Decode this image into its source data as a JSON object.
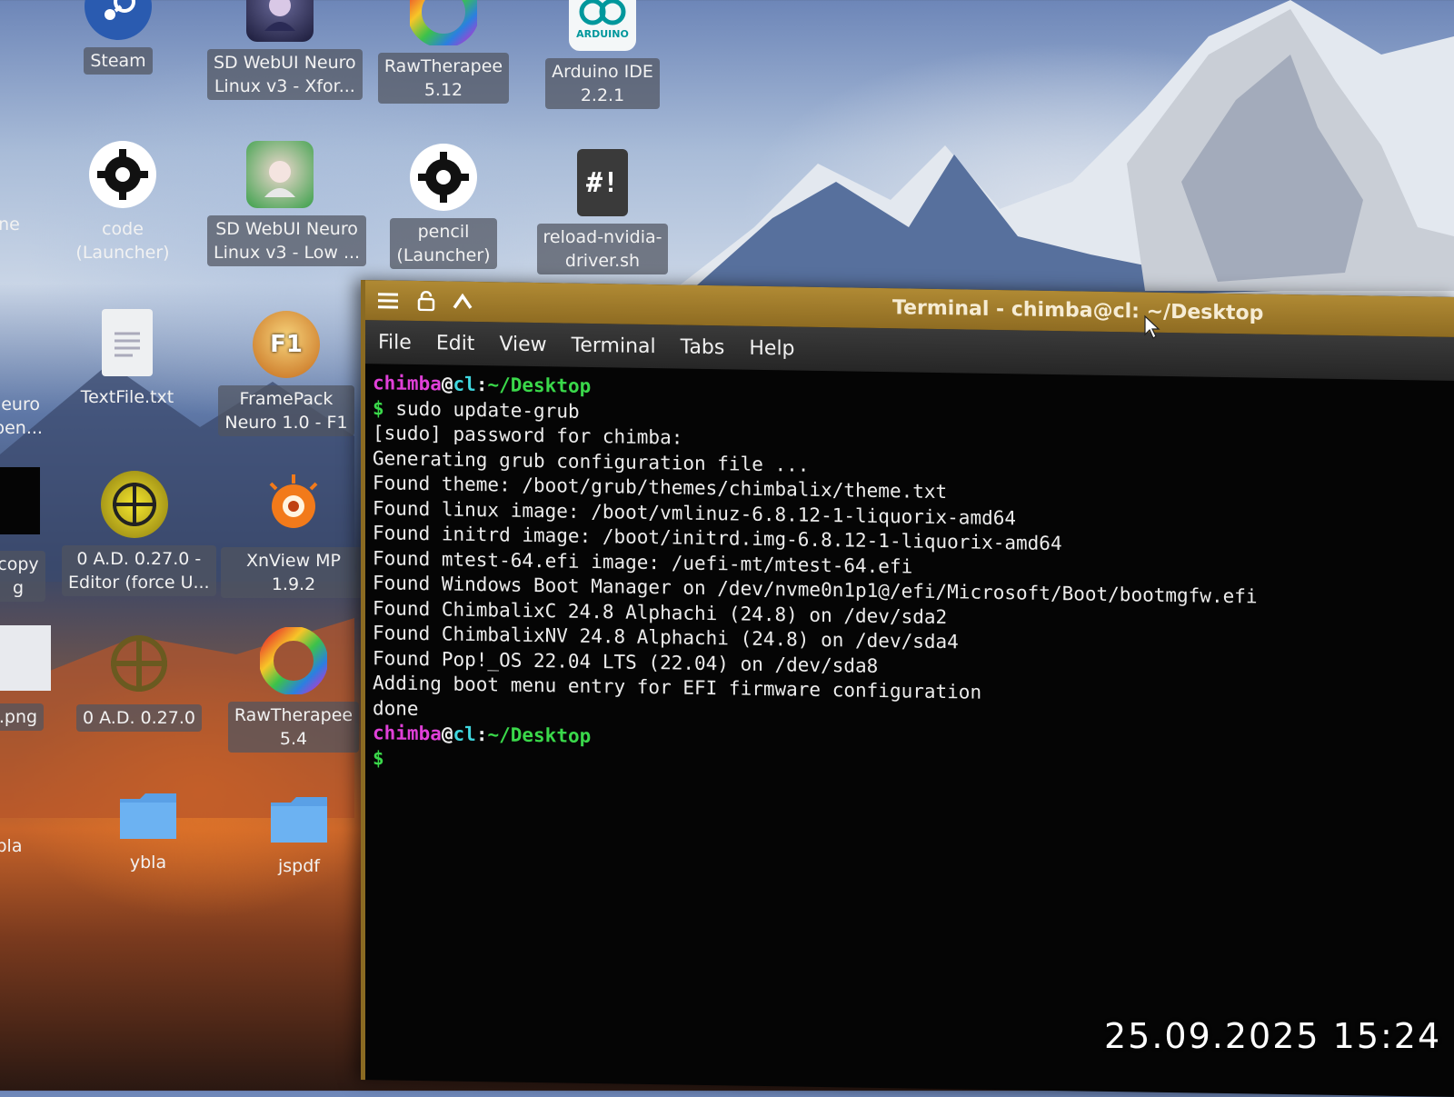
{
  "desktop": {
    "icons": [
      {
        "id": "steam",
        "label": "Steam",
        "icon": "steam-icon"
      },
      {
        "id": "sdwebui-xformers",
        "label": "SD WebUI Neuro\nLinux v3 - Xfor...",
        "icon": "anime-avatar-icon"
      },
      {
        "id": "rawtherapee-512",
        "label": "RawTherapee\n5.12",
        "icon": "color-wheel-icon"
      },
      {
        "id": "arduino",
        "label": "Arduino IDE\n2.2.1",
        "icon": "arduino-icon",
        "icon_text": "ARDUINO"
      },
      {
        "id": "partial-ne",
        "label": "ne",
        "icon": "partial-icon"
      },
      {
        "id": "code-launcher",
        "label": "code (Launcher)",
        "icon": "gear-icon"
      },
      {
        "id": "sdwebui-low",
        "label": "SD WebUI Neuro\nLinux v3 - Low ...",
        "icon": "anime-avatar-icon"
      },
      {
        "id": "pencil-launcher",
        "label": "pencil\n(Launcher)",
        "icon": "gear-icon"
      },
      {
        "id": "reload-nvidia",
        "label": "reload-nvidia-\ndriver.sh",
        "icon": "script-icon",
        "icon_text": "#!"
      },
      {
        "id": "partial-neuro",
        "label": "leuro\npen...",
        "icon": "partial-icon"
      },
      {
        "id": "textfile",
        "label": "TextFile.txt",
        "icon": "text-file-icon"
      },
      {
        "id": "framepack",
        "label": "FramePack\nNeuro 1.0 - F1",
        "icon": "framepack-icon",
        "icon_text": "F1"
      },
      {
        "id": "partial-copy",
        "label": "copy\ng",
        "icon": "partial-icon"
      },
      {
        "id": "0ad-editor",
        "label": "0 A.D. 0.27.0 -\nEditor (force U...",
        "icon": "crosshair-icon"
      },
      {
        "id": "xnview",
        "label": "XnView MP 1.9.2",
        "icon": "xnview-icon"
      },
      {
        "id": "partial-png",
        "label": ".png",
        "icon": "partial-icon"
      },
      {
        "id": "0ad",
        "label": "0 A.D. 0.27.0",
        "icon": "crosshair-icon"
      },
      {
        "id": "rawtherapee-54",
        "label": "RawTherapee\n5.4",
        "icon": "color-wheel-icon"
      },
      {
        "id": "partial-bla",
        "label": "bla",
        "icon": "partial-icon"
      },
      {
        "id": "ybla",
        "label": "ybla",
        "icon": "folder-icon"
      },
      {
        "id": "jspdf",
        "label": "jspdf",
        "icon": "folder-icon"
      }
    ]
  },
  "terminal": {
    "title": "Terminal - chimba@cl: ~/Desktop",
    "menu": [
      "File",
      "Edit",
      "View",
      "Terminal",
      "Tabs",
      "Help"
    ],
    "prompt": {
      "user": "chimba",
      "at": "@",
      "host": "cl",
      "sep": ":",
      "path": "~/Desktop",
      "dollar": "$"
    },
    "command": "sudo update-grub",
    "output": [
      "[sudo] password for chimba:",
      "Generating grub configuration file ...",
      "Found theme: /boot/grub/themes/chimbalix/theme.txt",
      "Found linux image: /boot/vmlinuz-6.8.12-1-liquorix-amd64",
      "Found initrd image: /boot/initrd.img-6.8.12-1-liquorix-amd64",
      "Found mtest-64.efi image: /uefi-mt/mtest-64.efi",
      "Found Windows Boot Manager on /dev/nvme0n1p1@/efi/Microsoft/Boot/bootmgfw.efi",
      "Found ChimbalixC 24.8 Alphachi (24.8) on /dev/sda2",
      "Found ChimbalixNV 24.8 Alphachi (24.8) on /dev/sda4",
      "Found Pop!_OS 22.04 LTS (22.04) on /dev/sda8",
      "Adding boot menu entry for EFI firmware configuration",
      "done"
    ]
  },
  "photo_timestamp": "25.09.2025 15:24",
  "colors": {
    "title_bar": "#9c7a2a",
    "prompt_user": "#e040d8",
    "prompt_host": "#40d8e0",
    "prompt_path": "#3ad84a"
  }
}
